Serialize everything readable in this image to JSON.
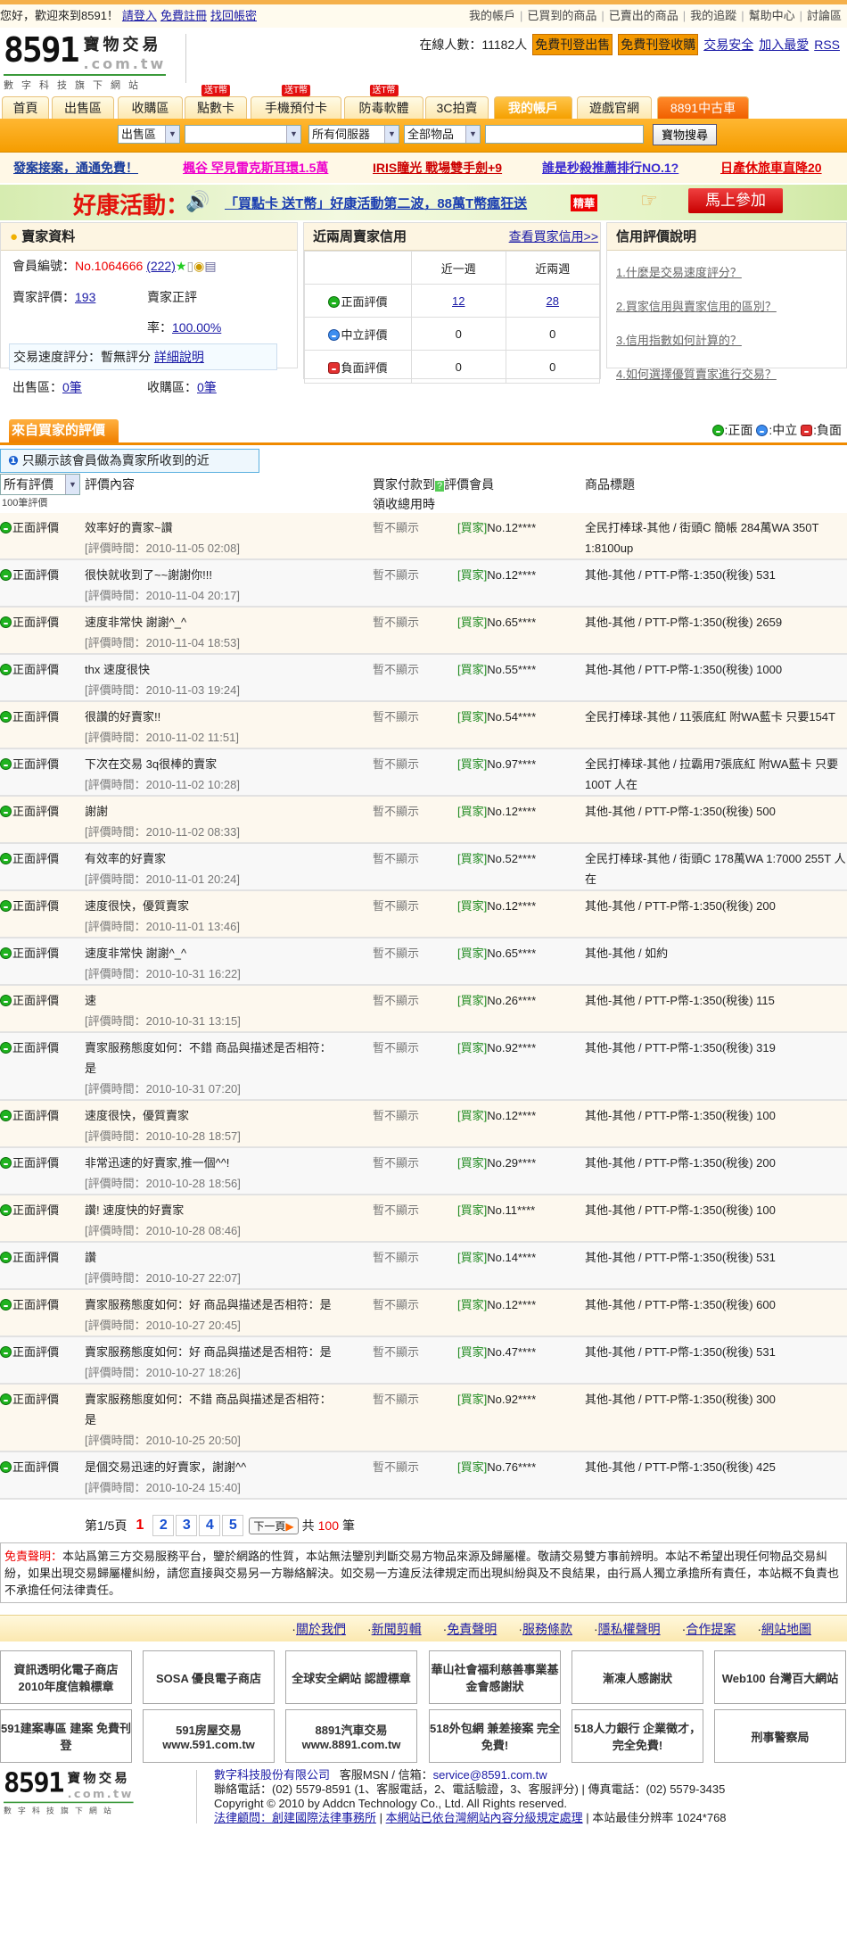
{
  "topbar": {
    "greeting": "您好，歡迎來到8591！",
    "login": "請登入",
    "register": "免費註冊",
    "recover": "找回帳密",
    "links": [
      "我的帳戶",
      "已買到的商品",
      "已賣出的商品",
      "我的追蹤",
      "幫助中心",
      "討論區"
    ]
  },
  "logo": {
    "digits": "8591",
    "name": "寶物交易",
    "domain": ".com.tw",
    "tagline": "數字科技旗下網站"
  },
  "header": {
    "online_label": "在線人數：11182人",
    "post_sell": "免費刊登出售",
    "post_buy": "免費刊登收購",
    "safety": "交易安全",
    "favorite": "加入最愛",
    "rss": "RSS"
  },
  "tabs": [
    {
      "label": "首頁"
    },
    {
      "label": "出售區"
    },
    {
      "label": "收購區"
    },
    {
      "label": "點數卡",
      "badge": "送T幣"
    },
    {
      "label": "手機預付卡",
      "badge": "送T幣"
    },
    {
      "label": "防毒軟體",
      "badge": "送T幣"
    },
    {
      "label": "3C拍賣"
    },
    {
      "label": "我的帳戶",
      "selected": true
    },
    {
      "label": "遊戲官網"
    },
    {
      "label": "8891中古車"
    }
  ],
  "search": {
    "area": "出售區",
    "game": "",
    "server": "所有伺服器",
    "category": "全部物品",
    "keyword": "",
    "button": "寶物搜尋"
  },
  "promos": [
    {
      "text": "發案接案，通通免費！",
      "color": "#1a3d9c"
    },
    {
      "text": "楓谷 罕見雷克斯耳環1.5萬",
      "color": "#ee00cc"
    },
    {
      "text": "IRIS瞳光 戰場雙手劍+9",
      "color": "#cc0000"
    },
    {
      "text": "誰是秒殺推薦排行NO.1?",
      "color": "#3a2ad0"
    },
    {
      "text": "日產休旅車直降20",
      "color": "#e00000"
    }
  ],
  "banner": {
    "title": "好康活動：",
    "link": "「買點卡 送T幣」好康活動第二波，88萬T幣瘋狂送",
    "tag": "精華",
    "button": "馬上參加"
  },
  "seller": {
    "title": "賣家資料",
    "member_label": "會員編號：",
    "member_no": "No.1064666",
    "member_count": "(222)",
    "rating_label": "賣家評價：",
    "rating": "193",
    "positive_label": "賣家正評",
    "rate_label": "率：",
    "rate": "100.00%",
    "speed_label": "交易速度評分：暫無評分",
    "speed_link": "詳細說明",
    "sell_label": "出售區：",
    "sell_count": "0筆",
    "buy_label": "收購區：",
    "buy_count": "0筆"
  },
  "credit": {
    "title": "近兩周賣家信用",
    "link": "查看買家信用>>",
    "col1": "近一週",
    "col2": "近兩週",
    "rows": [
      {
        "label": "正面評價",
        "w1": "12",
        "w2": "28"
      },
      {
        "label": "中立評價",
        "w1": "0",
        "w2": "0"
      },
      {
        "label": "負面評價",
        "w1": "0",
        "w2": "0"
      }
    ]
  },
  "explain": {
    "title": "信用評價說明",
    "items": [
      "1.什麼是交易速度評分？",
      "2.買家信用與賣家信用的區別？",
      "3.信用指數如何計算的？",
      "4.如何選擇優質賣家進行交易？"
    ]
  },
  "reviews_section": {
    "tab": "來自買家的評價",
    "legend_pos": ":正面",
    "legend_neu": ":中立",
    "legend_neg": ":負面",
    "notice": "只顯示該會員做為賣家所收到的近",
    "filter": "所有評價",
    "hidden_count": "100筆評價",
    "col_content": "評價內容",
    "col_pay": "買家付款到",
    "col_pay2": "領收總用時",
    "col_member": "評價會員",
    "col_title": "商品標題",
    "rating_type": "正面評價",
    "time_label": "評價時間：",
    "pay_hidden": "暫不顯示",
    "buyer_tag": "[買家]"
  },
  "reviews": [
    {
      "comment": "效率好的賣家~讚",
      "time": "2010-11-05 02:08",
      "buyer": "No.12****",
      "title": "全民打棒球-其他 / 街頭C 簡帳 284萬WA 350T 1:8100up"
    },
    {
      "comment": "很快就收到了~~謝謝你!!!",
      "time": "2010-11-04 20:17",
      "buyer": "No.12****",
      "title": "其他-其他 / PTT-P幣-1:350(稅後) 531"
    },
    {
      "comment": "速度非常快 謝謝^_^",
      "time": "2010-11-04 18:53",
      "buyer": "No.65****",
      "title": "其他-其他 / PTT-P幣-1:350(稅後) 2659"
    },
    {
      "comment": "thx 速度很快",
      "time": "2010-11-03 19:24",
      "buyer": "No.55****",
      "title": "其他-其他 / PTT-P幣-1:350(稅後) 1000"
    },
    {
      "comment": "很讚的好賣家!!",
      "time": "2010-11-02 11:51",
      "buyer": "No.54****",
      "title": "全民打棒球-其他 / 11張底紅 附WA藍卡 只要154T"
    },
    {
      "comment": "下次在交易 3q很棒的賣家",
      "time": "2010-11-02 10:28",
      "buyer": "No.97****",
      "title": "全民打棒球-其他 / 拉霸用7張底紅 附WA藍卡 只要100T 人在"
    },
    {
      "comment": "謝謝",
      "time": "2010-11-02 08:33",
      "buyer": "No.12****",
      "title": "其他-其他 / PTT-P幣-1:350(稅後) 500"
    },
    {
      "comment": "有效率的好賣家",
      "time": "2010-11-01 20:24",
      "buyer": "No.52****",
      "title": "全民打棒球-其他 / 街頭C 178萬WA 1:7000 255T 人在"
    },
    {
      "comment": "速度很快，優質賣家",
      "time": "2010-11-01 13:46",
      "buyer": "No.12****",
      "title": "其他-其他 / PTT-P幣-1:350(稅後) 200"
    },
    {
      "comment": "速度非常快 謝謝^_^",
      "time": "2010-10-31 16:22",
      "buyer": "No.65****",
      "title": "其他-其他 / 如約"
    },
    {
      "comment": "速",
      "time": "2010-10-31 13:15",
      "buyer": "No.26****",
      "title": "其他-其他 / PTT-P幣-1:350(稅後) 115"
    },
    {
      "comment": "賣家服務態度如何：不錯 商品與描述是否相符：是",
      "time": "2010-10-31 07:20",
      "buyer": "No.92****",
      "title": "其他-其他 / PTT-P幣-1:350(稅後) 319"
    },
    {
      "comment": "速度很快，優質賣家",
      "time": "2010-10-28 18:57",
      "buyer": "No.12****",
      "title": "其他-其他 / PTT-P幣-1:350(稅後) 100"
    },
    {
      "comment": "非常迅速的好賣家,推一個^^!",
      "time": "2010-10-28 18:56",
      "buyer": "No.29****",
      "title": "其他-其他 / PTT-P幣-1:350(稅後) 200"
    },
    {
      "comment": "讚! 速度快的好賣家",
      "time": "2010-10-28 08:46",
      "buyer": "No.11****",
      "title": "其他-其他 / PTT-P幣-1:350(稅後) 100"
    },
    {
      "comment": "讚",
      "time": "2010-10-27 22:07",
      "buyer": "No.14****",
      "title": "其他-其他 / PTT-P幣-1:350(稅後) 531"
    },
    {
      "comment": "賣家服務態度如何：好 商品與描述是否相符：是",
      "time": "2010-10-27 20:45",
      "buyer": "No.12****",
      "title": "其他-其他 / PTT-P幣-1:350(稅後) 600"
    },
    {
      "comment": "賣家服務態度如何：好 商品與描述是否相符：是",
      "time": "2010-10-27 18:26",
      "buyer": "No.47****",
      "title": "其他-其他 / PTT-P幣-1:350(稅後) 531"
    },
    {
      "comment": "賣家服務態度如何：不錯 商品與描述是否相符：是",
      "time": "2010-10-25 20:50",
      "buyer": "No.92****",
      "title": "其他-其他 / PTT-P幣-1:350(稅後) 300"
    },
    {
      "comment": "是個交易迅速的好賣家，謝謝^^",
      "time": "2010-10-24 15:40",
      "buyer": "No.76****",
      "title": "其他-其他 / PTT-P幣-1:350(稅後) 425"
    }
  ],
  "pagination": {
    "page_info": "第1/5頁",
    "current": "1",
    "pages": [
      "2",
      "3",
      "4",
      "5"
    ],
    "next": "下一頁",
    "total_prefix": "共",
    "total": "100",
    "total_suffix": "筆"
  },
  "disclaimer": {
    "label": "免責聲明：",
    "text": "本站爲第三方交易服務平台，鑒於網路的性質，本站無法鑒別判斷交易方物品來源及歸屬權。敬請交易雙方事前辨明。本站不希望出現任何物品交易糾紛，如果出現交易歸屬權糾紛，請您直接與交易另一方聯絡解決。如交易一方違反法律規定而出現糾紛與及不良結果，由行爲人獨立承擔所有責任，本站概不負責也不承擔任何法律責任。"
  },
  "footer_links": [
    "關於我們",
    "新聞剪輯",
    "免責聲明",
    "服務條款",
    "隱私權聲明",
    "合作提案",
    "網站地圖"
  ],
  "footer_badges": [
    "資訊透明化電子商店 2010年度信賴標章",
    "SOSA 優良電子商店",
    "全球安全網站 認證標章",
    "華山社會福利慈善事業基金會感謝狀",
    "漸凍人感謝狀",
    "Web100 台灣百大網站",
    "591建案專區 建案 免費刊登",
    "591房屋交易 www.591.com.tw",
    "8891汽車交易 www.8891.com.tw",
    "518外包網 兼差接案 完全免費!",
    "518人力銀行 企業徵才，完全免費!",
    "刑事警察局"
  ],
  "footer": {
    "company": "數字科技股份有限公司",
    "msn_label": "客服MSN / 信箱：",
    "email": "service@8591.com.tw",
    "phone": "聯絡電話：(02) 5579-8591 (1、客服電話，2、電話驗證，3、客服評分) | 傳真電話：(02) 5579-3435",
    "copyright": "Copyright © 2010 by Addcn Technology Co., Ltd. All Rights reserved.",
    "legal": "法律顧問：創建國際法律事務所",
    "rating": "本網站已依台灣網站內容分級規定處理",
    "resolution": "| 本站最佳分辨率 1024*768"
  }
}
